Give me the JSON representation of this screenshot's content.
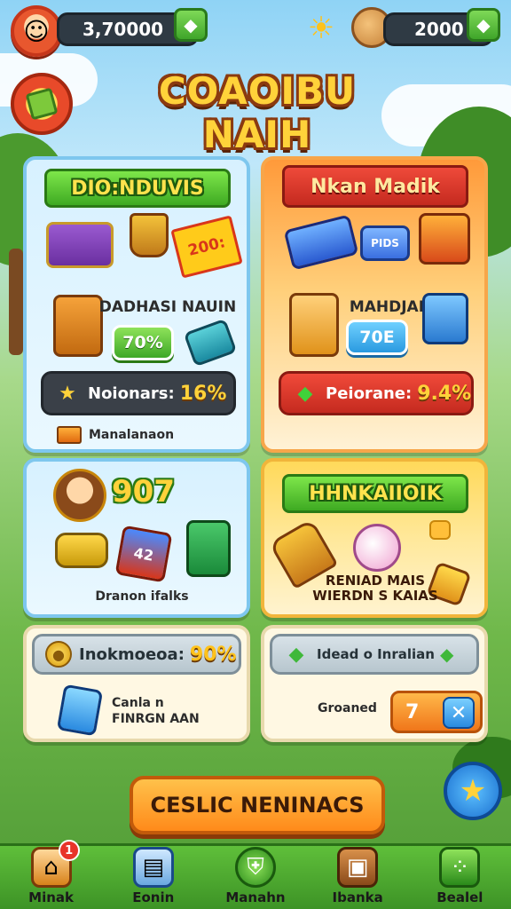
{
  "header": {
    "coins": "3,70000",
    "gems": "2000",
    "title": "COAOIBU NAIH"
  },
  "cards": {
    "daily": {
      "ribbon": "DIO:NDUVIS",
      "price_tag": "200:",
      "item_name": "DADHASI NAUIN",
      "button_value": "70%",
      "stat_label": "Noionars:",
      "stat_value": "16%",
      "footer": "Manalanaon"
    },
    "market": {
      "ribbon": "Nkan Madik",
      "card_text": "PIDS",
      "item_name": "MAHDJARAN",
      "button_value": "70E",
      "stat_label": "Peiorane:",
      "stat_value": "9.4%"
    },
    "profile": {
      "level": "907",
      "tile_number": "42",
      "footer": "Dranon ifalks"
    },
    "event": {
      "ribbon": "HHNKAIIOIK",
      "text_line1": "RENIAD MAIS",
      "text_line2": "WIERDN S KAIAS"
    },
    "bonus": {
      "stat_label": "Inokmoeoa:",
      "stat_value": "90%",
      "desc_line1": "Canla n",
      "desc_line2": "FINRGN AAN"
    },
    "reward": {
      "stat_label": "Idead o Inralian",
      "caption": "Groaned",
      "count": "7"
    }
  },
  "main_button": "CESLIC NENINACS",
  "nav": [
    {
      "label": "Minak",
      "icon": "home-icon",
      "badge": "1"
    },
    {
      "label": "Eonin",
      "icon": "cards-icon"
    },
    {
      "label": "Manahn",
      "icon": "shield-icon"
    },
    {
      "label": "Ibanka",
      "icon": "chest-icon"
    },
    {
      "label": "Bealel",
      "icon": "grid-icon"
    }
  ],
  "colors": {
    "accent_gold": "#ffd23a",
    "green": "#3ea827",
    "orange": "#ff8a1a",
    "red": "#c42a1f",
    "blue": "#2a9ae0"
  }
}
